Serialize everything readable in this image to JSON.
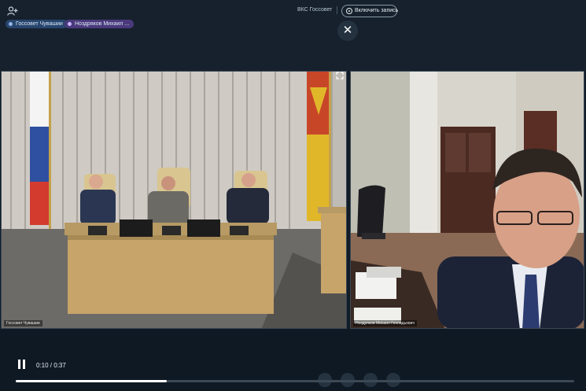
{
  "header": {
    "conference_title": "ВКС Госсовет",
    "record_button_label": "Включить запись"
  },
  "participants": [
    {
      "label": "Госсовет Чувашии",
      "color": "#27456d"
    },
    {
      "label": "Ноздряков Михаил ...",
      "color": "#4a3a7c"
    }
  ],
  "tiles": {
    "left_name": "Госсовет Чувашии",
    "right_name": "Ноздряков Михаил Геннадьевич"
  },
  "player": {
    "time_display": "0:10 / 0:37",
    "progress_fraction": 0.27
  },
  "icons": {
    "add_user": "add-user-icon",
    "record": "record-icon",
    "close": "close-icon",
    "pause": "pause-icon",
    "fullscreen": "fullscreen-icon"
  },
  "colors": {
    "background": "#111c27",
    "accent_blue": "#27456d",
    "accent_purple": "#4a3a7c"
  }
}
